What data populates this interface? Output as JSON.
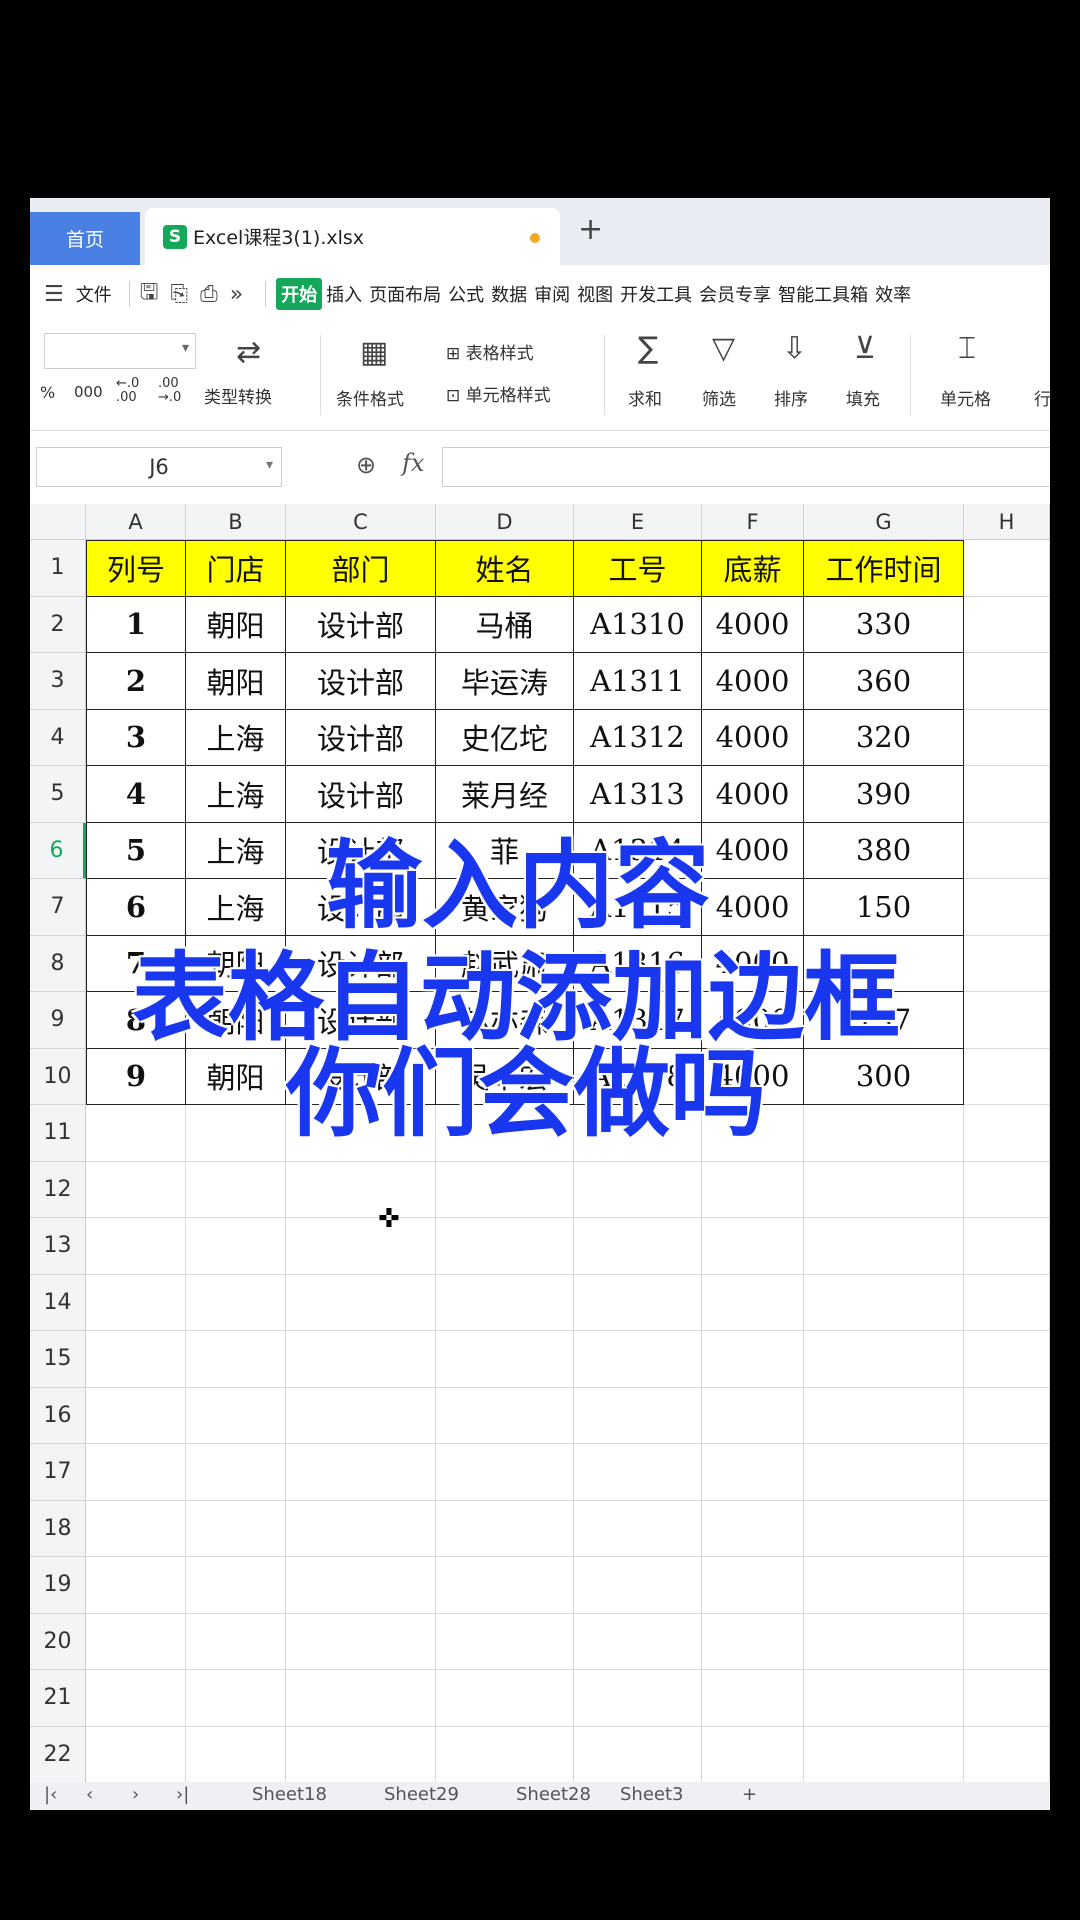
{
  "tabs": {
    "home": "首页",
    "file": "Excel课程3(1).xlsx",
    "add": "+"
  },
  "menu": {
    "file": "文件",
    "more": "»",
    "items": [
      "开始",
      "插入",
      "页面布局",
      "公式",
      "数据",
      "审阅",
      "视图",
      "开发工具",
      "会员专享",
      "智能工具箱",
      "效率"
    ]
  },
  "ribbon": {
    "number_formats": [
      "%",
      "000",
      "←.0\n.00",
      ".00\n→.0"
    ],
    "type_convert": "类型转换",
    "cond_format": "条件格式",
    "table_style": "表格样式",
    "cell_style": "单元格样式",
    "sum": "求和",
    "filter": "筛选",
    "sort": "排序",
    "fill": "填充",
    "cell": "单元格",
    "row": "行"
  },
  "formula_bar": {
    "name_box": "J6",
    "fx": "fx",
    "value": ""
  },
  "columns": [
    "A",
    "B",
    "C",
    "D",
    "E",
    "F",
    "G",
    "H"
  ],
  "rows": [
    "1",
    "2",
    "3",
    "4",
    "5",
    "6",
    "7",
    "8",
    "9",
    "10",
    "11",
    "12",
    "13",
    "14",
    "15",
    "16",
    "17",
    "18",
    "19",
    "20",
    "21",
    "22"
  ],
  "selected_row": "6",
  "table": {
    "header": [
      "列号",
      "门店",
      "部门",
      "姓名",
      "工号",
      "底薪",
      "工作时间"
    ],
    "rows": [
      [
        "1",
        "朝阳",
        "设计部",
        "马桶",
        "A1310",
        "4000",
        "330"
      ],
      [
        "2",
        "朝阳",
        "设计部",
        "毕运涛",
        "A1311",
        "4000",
        "360"
      ],
      [
        "3",
        "上海",
        "设计部",
        "史亿坨",
        "A1312",
        "4000",
        "320"
      ],
      [
        "4",
        "上海",
        "设计部",
        "莱月经",
        "A1313",
        "4000",
        "390"
      ],
      [
        "5",
        "上海",
        "设计部",
        "菲",
        "A1314",
        "4000",
        "380"
      ],
      [
        "6",
        "上海",
        "设计部",
        "黄家狗",
        "A1315",
        "4000",
        "150"
      ],
      [
        "7",
        "朝阳",
        "设计部",
        "赵武肃",
        "A1316",
        "4000",
        ""
      ],
      [
        "8",
        "朝阳",
        "设计部",
        "赵亦森",
        "A1317",
        "4000",
        "137"
      ],
      [
        "9",
        "朝阳",
        "设计部",
        "吴卓宏",
        "A1318",
        "4000",
        "300"
      ]
    ]
  },
  "sheets": [
    "Sheet18",
    "Sheet29",
    "Sheet28",
    "Sheet3"
  ],
  "caption": {
    "line1": "输入内容",
    "line2": "表格自动添加边框",
    "line3": "你们会做吗"
  },
  "colors": {
    "accent": "#15a85b",
    "home_tab": "#4a7fe3",
    "header_fill": "#ffff00",
    "caption": "#1837ef"
  }
}
